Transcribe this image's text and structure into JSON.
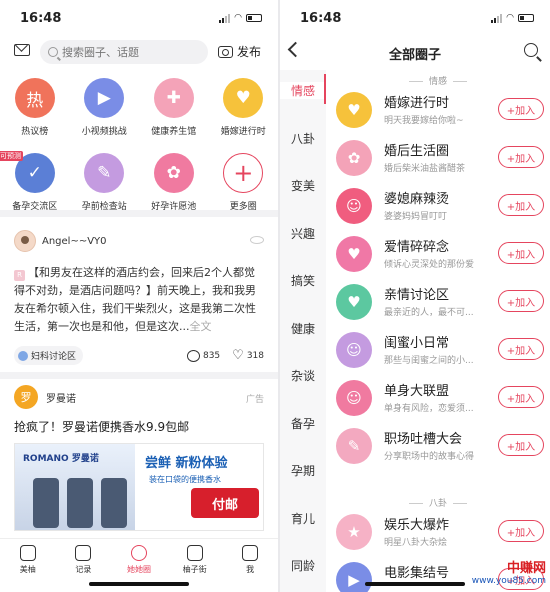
{
  "left": {
    "status_time": "16:48",
    "search_placeholder": "搜索圈子、话题",
    "publish_label": "发布",
    "circles": [
      {
        "label": "热议榜",
        "glyph": "热",
        "color": "#f0735b",
        "badge": ""
      },
      {
        "label": "小视频挑战",
        "glyph": "▶",
        "color": "#7a8de6",
        "badge": ""
      },
      {
        "label": "健康养生馆",
        "glyph": "✚",
        "color": "#f4a3b8",
        "badge": ""
      },
      {
        "label": "婚嫁进行时",
        "glyph": "♥",
        "color": "#f6c23b",
        "badge": ""
      },
      {
        "label": "备孕交流区",
        "glyph": "✓",
        "color": "#5b7fd6",
        "badge": "可预测"
      },
      {
        "label": "孕前检查站",
        "glyph": "✎",
        "color": "#c49be0",
        "badge": ""
      },
      {
        "label": "好孕许愿池",
        "glyph": "✿",
        "color": "#f07aa0",
        "badge": ""
      },
      {
        "label": "更多圈",
        "glyph": "+",
        "color": "#e5455e",
        "badge": ""
      }
    ],
    "post1": {
      "author": "Angel~~VY0",
      "mark": "R",
      "text": "【和男友在这样的酒店约会，回来后2个人都觉得不对劲，是酒店问题吗？】前天晚上，我和我男友在希尔顿入住，我们干柴烈火，这是我第二次性生活，第一次也是和他，但是这次...",
      "tail": "全文",
      "circle_tag": "妇科讨论区",
      "comments": "835",
      "likes": "318"
    },
    "post2": {
      "avatar": "罗",
      "author": "罗曼诺",
      "ad_label": "广告",
      "title": "抢疯了！罗曼诺便携香水9.9包邮",
      "brand": "ROMANO 罗曼诺",
      "headline": "尝鲜 新粉体验",
      "sub": "装在口袋的便携香水",
      "free_ship": "付邮"
    },
    "tabs": [
      {
        "label": "美柚",
        "active": false
      },
      {
        "label": "记录",
        "active": false
      },
      {
        "label": "她她圈",
        "active": true
      },
      {
        "label": "柚子街",
        "active": false
      },
      {
        "label": "我",
        "active": false
      }
    ]
  },
  "right": {
    "status_time": "16:48",
    "title": "全部圈子",
    "categories": [
      "情感",
      "八卦",
      "变美",
      "兴趣",
      "搞笑",
      "健康",
      "杂谈",
      "备孕",
      "孕期",
      "育儿",
      "同龄"
    ],
    "section1": "情感",
    "groups": [
      {
        "name": "婚嫁进行时",
        "desc": "明天我要嫁给你啦~",
        "color": "#f6c23b",
        "glyph": "♥"
      },
      {
        "name": "婚后生活圈",
        "desc": "婚后柴米油盐酱醋茶",
        "color": "#f4a3b8",
        "glyph": "✿"
      },
      {
        "name": "婆媳麻辣烫",
        "desc": "婆婆妈妈冒叮叮",
        "color": "#f05d7f",
        "glyph": "☺"
      },
      {
        "name": "爱情碎碎念",
        "desc": "倾诉心灵深处的那份爱",
        "color": "#f078a6",
        "glyph": "♥"
      },
      {
        "name": "亲情讨论区",
        "desc": "最亲近的人，最不可...",
        "color": "#5cc8a0",
        "glyph": "♥"
      },
      {
        "name": "闺蜜小日常",
        "desc": "那些与闺蜜之间的小...",
        "color": "#c49be0",
        "glyph": "☺"
      },
      {
        "name": "单身大联盟",
        "desc": "单身有风险，恋爱须...",
        "color": "#f07aa0",
        "glyph": "☺"
      },
      {
        "name": "职场吐槽大会",
        "desc": "分享职场中的故事心得",
        "color": "#f3a9c0",
        "glyph": "✎"
      }
    ],
    "section2": "八卦",
    "groups2": [
      {
        "name": "娱乐大爆炸",
        "desc": "明星八卦大杂烩",
        "color": "#f6b2c6",
        "glyph": "★"
      },
      {
        "name": "电影集结号",
        "desc": "",
        "color": "#7a8de6",
        "glyph": "▶"
      }
    ],
    "join_label": "+加入",
    "watermark_cn": "中赚网",
    "watermark_url": "www.you85.com"
  }
}
